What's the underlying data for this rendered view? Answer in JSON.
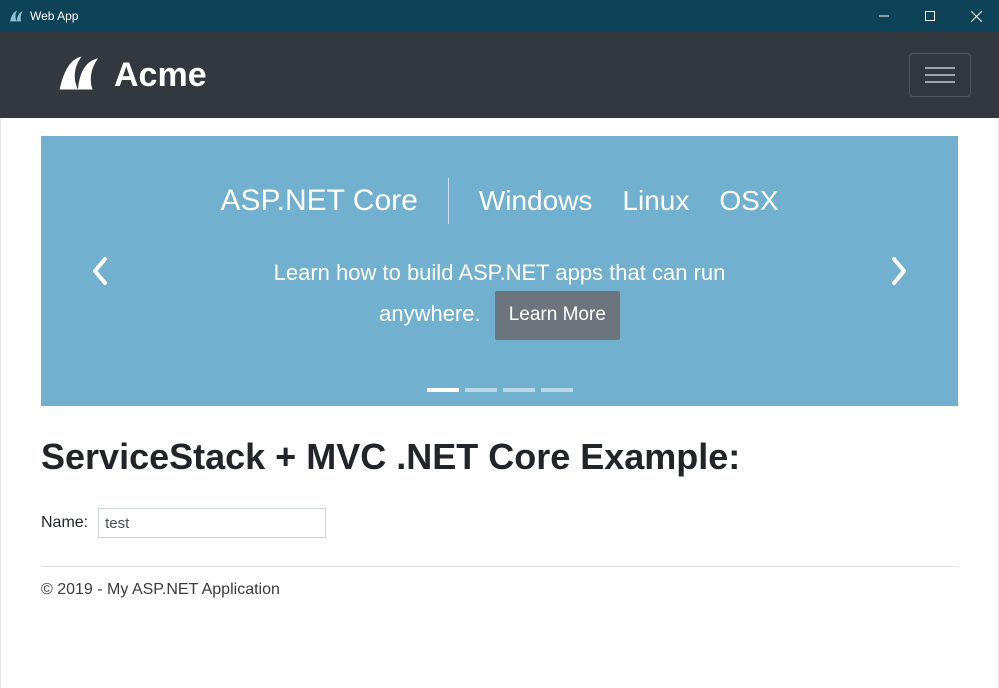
{
  "titlebar": {
    "title": "Web App"
  },
  "navbar": {
    "brand": "Acme"
  },
  "carousel": {
    "tabs": [
      "ASP.NET Core",
      "Windows",
      "Linux",
      "OSX"
    ],
    "active_tab_index": 0,
    "body_text": "Learn how to build ASP.NET apps that can run anywhere.",
    "learn_more_label": "Learn More",
    "indicator_count": 4,
    "active_indicator": 0
  },
  "section": {
    "heading": "ServiceStack + MVC .NET Core Example:"
  },
  "form": {
    "name_label": "Name:",
    "name_value": "test"
  },
  "footer": {
    "text": "© 2019 - My ASP.NET Application"
  }
}
